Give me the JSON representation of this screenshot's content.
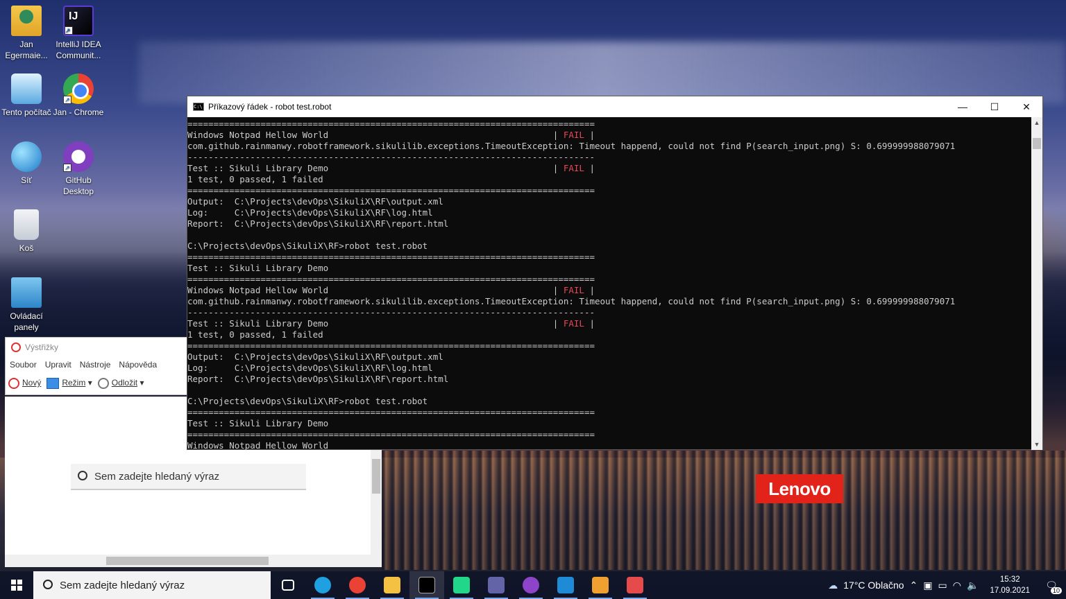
{
  "desktop": {
    "icons": [
      {
        "label": "Jan Egermaie...",
        "icon": "user-folder-icon"
      },
      {
        "label": "IntelliJ IDEA Communit...",
        "icon": "intellij-icon",
        "glyph": "IJ"
      },
      {
        "label": "Tento počítač",
        "icon": "this-pc-icon"
      },
      {
        "label": "Jan - Chrome",
        "icon": "chrome-icon"
      },
      {
        "label": "Síť",
        "icon": "network-icon"
      },
      {
        "label": "GitHub Desktop",
        "icon": "github-desktop-icon"
      },
      {
        "label": "Koš",
        "icon": "recycle-bin-icon"
      },
      {
        "label": "Ovládací panely",
        "icon": "control-panel-icon"
      }
    ],
    "brand": "Lenovo"
  },
  "cmd": {
    "title": "Příkazový řádek - robot  test.robot",
    "icon_text": "C:\\",
    "buttons": {
      "minimize": "—",
      "maximize": "☐",
      "close": "✕"
    },
    "lines": [
      {
        "text": "=============================================================================="
      },
      {
        "text": "Windows Notpad Hellow World                                           | ",
        "fail": "FAIL",
        "tail": " |"
      },
      {
        "text": "com.github.rainmanwy.robotframework.sikulilib.exceptions.TimeoutException: Timeout happend, could not find P(search_input.png) S: 0.699999988079071"
      },
      {
        "text": "------------------------------------------------------------------------------"
      },
      {
        "text": "Test :: Sikuli Library Demo                                           | ",
        "fail": "FAIL",
        "tail": " |"
      },
      {
        "text": "1 test, 0 passed, 1 failed"
      },
      {
        "text": "=============================================================================="
      },
      {
        "text": "Output:  C:\\Projects\\devOps\\SikuliX\\RF\\output.xml"
      },
      {
        "text": "Log:     C:\\Projects\\devOps\\SikuliX\\RF\\log.html"
      },
      {
        "text": "Report:  C:\\Projects\\devOps\\SikuliX\\RF\\report.html"
      },
      {
        "text": ""
      },
      {
        "text": "C:\\Projects\\devOps\\SikuliX\\RF>robot test.robot"
      },
      {
        "text": "=============================================================================="
      },
      {
        "text": "Test :: Sikuli Library Demo"
      },
      {
        "text": "=============================================================================="
      },
      {
        "text": "Windows Notpad Hellow World                                           | ",
        "fail": "FAIL",
        "tail": " |"
      },
      {
        "text": "com.github.rainmanwy.robotframework.sikulilib.exceptions.TimeoutException: Timeout happend, could not find P(search_input.png) S: 0.699999988079071"
      },
      {
        "text": "------------------------------------------------------------------------------"
      },
      {
        "text": "Test :: Sikuli Library Demo                                           | ",
        "fail": "FAIL",
        "tail": " |"
      },
      {
        "text": "1 test, 0 passed, 1 failed"
      },
      {
        "text": "=============================================================================="
      },
      {
        "text": "Output:  C:\\Projects\\devOps\\SikuliX\\RF\\output.xml"
      },
      {
        "text": "Log:     C:\\Projects\\devOps\\SikuliX\\RF\\log.html"
      },
      {
        "text": "Report:  C:\\Projects\\devOps\\SikuliX\\RF\\report.html"
      },
      {
        "text": ""
      },
      {
        "text": "C:\\Projects\\devOps\\SikuliX\\RF>robot test.robot"
      },
      {
        "text": "=============================================================================="
      },
      {
        "text": "Test :: Sikuli Library Demo"
      },
      {
        "text": "=============================================================================="
      },
      {
        "text": "Windows Notpad Hellow World"
      }
    ],
    "fail_color": "#e74856"
  },
  "snipping_tool": {
    "title": "Výstřižky",
    "menu": [
      "Soubor",
      "Upravit",
      "Nástroje",
      "Nápověda"
    ],
    "new_label": "Nový",
    "mode_label": "Režim",
    "delay_label": "Odložit"
  },
  "window_search": {
    "placeholder": "Sem zadejte hledaný výraz"
  },
  "taskbar": {
    "search_placeholder": "Sem zadejte hledaný výraz",
    "apps": [
      {
        "name": "task-view-icon",
        "color": "#ffffff"
      },
      {
        "name": "edge-icon",
        "color": "#1fa0e0"
      },
      {
        "name": "chrome-icon",
        "color": "#ea4335"
      },
      {
        "name": "file-explorer-icon",
        "color": "#f5c142"
      },
      {
        "name": "command-prompt-icon",
        "color": "#000000"
      },
      {
        "name": "pycharm-icon",
        "color": "#21d789"
      },
      {
        "name": "teams-icon",
        "color": "#6264a7"
      },
      {
        "name": "github-desktop-icon",
        "color": "#8e44c9"
      },
      {
        "name": "vscode-icon",
        "color": "#1f8ad6"
      },
      {
        "name": "paint-icon",
        "color": "#f0a030"
      },
      {
        "name": "snipping-tool-icon",
        "color": "#e64b4b"
      }
    ],
    "weather": "17°C  Oblačno",
    "time": "15:32",
    "date": "17.09.2021",
    "notifications": "10"
  }
}
